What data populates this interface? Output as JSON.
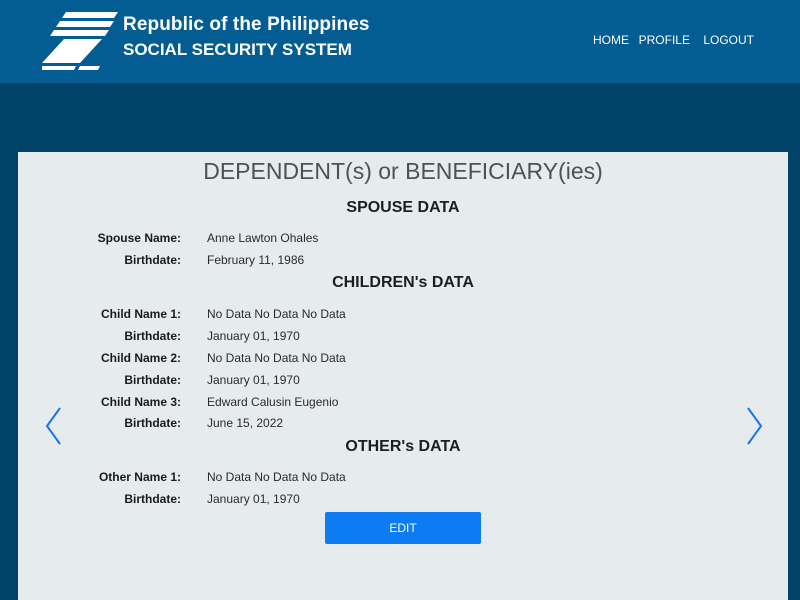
{
  "header": {
    "org_line1": "Republic of the Philippines",
    "org_line2": "SOCIAL SECURITY SYSTEM",
    "logo_icon": "sss-logo",
    "nav": {
      "home": "HOME",
      "profile": "PROFILE",
      "logout": "LOGOUT"
    }
  },
  "page": {
    "title": "DEPENDENT(s) or BENEFICIARY(ies)",
    "spouse": {
      "heading": "SPOUSE DATA",
      "name_label": "Spouse Name:",
      "name": "Anne Lawton Ohales",
      "birthdate_label": "Birthdate:",
      "birthdate": "February 11, 1986"
    },
    "children": {
      "heading": "CHILDREN's DATA",
      "items": [
        {
          "name_label": "Child Name 1:",
          "name": "No Data No Data No Data",
          "birthdate_label": "Birthdate:",
          "birthdate": "January 01, 1970"
        },
        {
          "name_label": "Child Name 2:",
          "name": "No Data No Data No Data",
          "birthdate_label": "Birthdate:",
          "birthdate": "January 01, 1970"
        },
        {
          "name_label": "Child Name 3:",
          "name": "Edward Calusin Eugenio",
          "birthdate_label": "Birthdate:",
          "birthdate": "June 15, 2022"
        }
      ]
    },
    "others": {
      "heading": "OTHER's DATA",
      "items": [
        {
          "name_label": "Other Name 1:",
          "name": "No Data No Data No Data",
          "birthdate_label": "Birthdate:",
          "birthdate": "January 01, 1970"
        }
      ]
    },
    "edit_label": "EDIT",
    "prev_icon": "chevron-left-icon",
    "next_icon": "chevron-right-icon"
  },
  "colors": {
    "header_bg": "#045d92",
    "page_bg": "#024469",
    "panel_bg": "#e6ebee",
    "accent": "#0d7bf2"
  }
}
